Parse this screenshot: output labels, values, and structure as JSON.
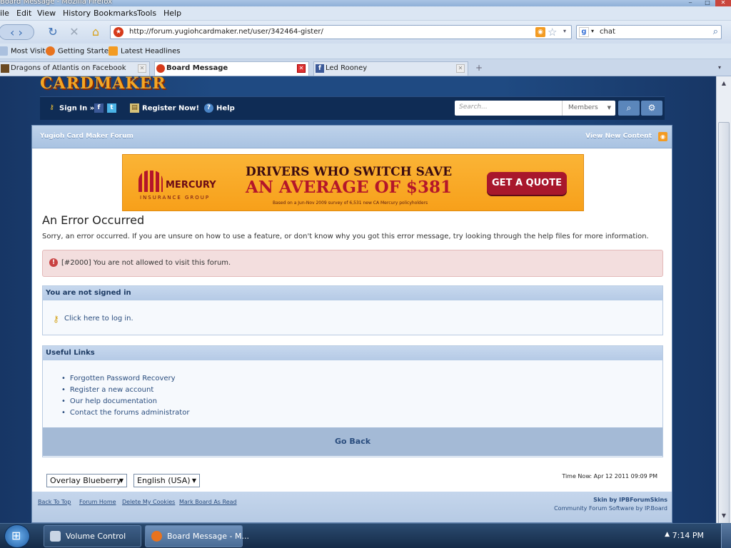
{
  "window": {
    "title": "Board Message - Mozilla Firefox"
  },
  "menu": [
    "ile",
    "Edit",
    "View",
    "History",
    "Bookmarks",
    "Tools",
    "Help"
  ],
  "nav": {
    "url": "http://forum.yugiohcardmaker.net/user/342464-gister/",
    "search_value": "chat"
  },
  "bookmarks": [
    {
      "label": "Most Visited",
      "icon": "bookmark-star-icon"
    },
    {
      "label": "Getting Started",
      "icon": "firefox-icon"
    },
    {
      "label": "Latest Headlines",
      "icon": "rss-icon"
    }
  ],
  "tabs": [
    {
      "label": "Dragons of Atlantis on Facebook"
    },
    {
      "label": "Board Message"
    },
    {
      "label": "Led Rooney"
    }
  ],
  "site": {
    "logo_text": "CARDMAKER",
    "userbar": {
      "sign_in": "Sign In »",
      "register": "Register Now!",
      "help": "Help",
      "search_placeholder": "Search...",
      "search_scope": "Members"
    },
    "breadcrumb": "Yugioh Card Maker Forum",
    "view_new": "View New Content",
    "ad": {
      "brand": "MERCURY",
      "brand_sub": "INSURANCE GROUP",
      "headline1": "DRIVERS WHO SWITCH SAVE",
      "headline2": "AN AVERAGE OF $381",
      "fine": "Based on a Jun-Nov 2009 survey of 6,531 new CA Mercury policyholders",
      "cta": "GET A QUOTE"
    },
    "error": {
      "title": "An Error Occurred",
      "description": "Sorry, an error occurred. If you are unsure on how to use a feature, or don't know why you got this error message, try looking through the help files for more information.",
      "message": "[#2000] You are not allowed to visit this forum."
    },
    "signin_panel": {
      "header": "You are not signed in",
      "link": "Click here to log in."
    },
    "links_panel": {
      "header": "Useful Links",
      "links": [
        "Forgotten Password Recovery",
        "Register a new account",
        "Our help documentation",
        "Contact the forums administrator"
      ],
      "go_back": "Go Back"
    },
    "skin_select": "Overlay Blueberry",
    "lang_select": "English (USA)",
    "time_now": "Time Now: Apr 12 2011 09:09 PM",
    "footer": {
      "links": [
        "Back To Top",
        "Forum Home",
        "Delete My Cookies",
        "Mark Board As Read"
      ],
      "skin_credit": "Skin by IPBForumSkins",
      "software_credit": "Community Forum Software by IP.Board"
    }
  },
  "taskbar": {
    "items": [
      {
        "label": "Volume Control"
      },
      {
        "label": "Board Message - M..."
      }
    ],
    "clock": "7:14 PM"
  }
}
